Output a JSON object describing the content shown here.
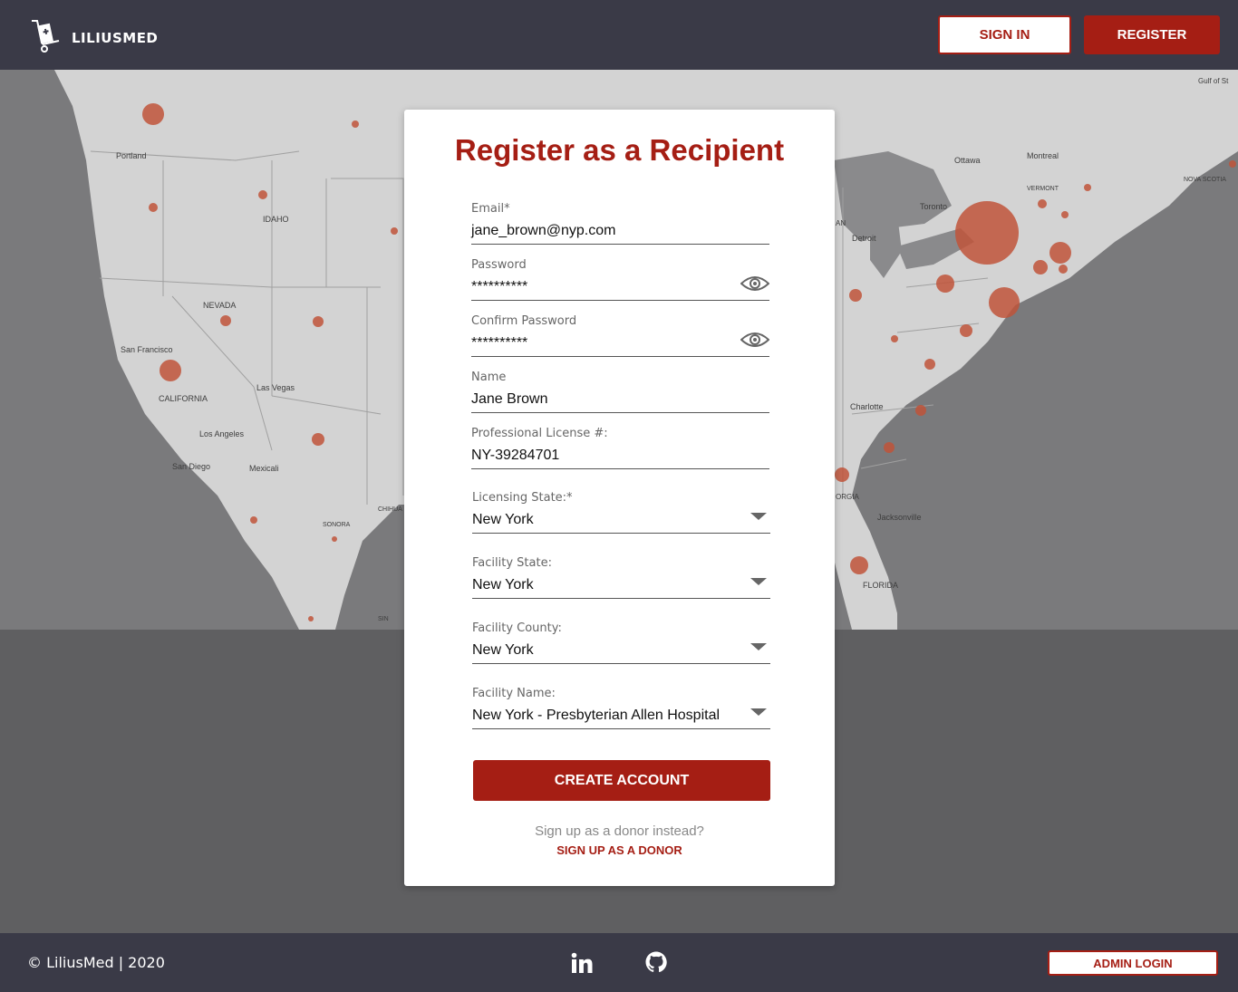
{
  "brand": {
    "name": "LILIUSMED",
    "accent": "#a51e14",
    "header_bg": "#3a3a47"
  },
  "header": {
    "signin_label": "SIGN IN",
    "register_label": "REGISTER"
  },
  "map": {
    "cities": [
      "Portland",
      "IDAHO",
      "NEVADA",
      "San Francisco",
      "CALIFORNIA",
      "Las Vegas",
      "Los Angeles",
      "San Diego",
      "Mexicali",
      "SONORA",
      "CHIHUA",
      "SIN",
      "Ottawa",
      "Montreal",
      "VERMONT",
      "NOVA SCOTIA",
      "Toronto",
      "AN",
      "Detroit",
      "Charlotte",
      "ORGIA",
      "Jacksonville",
      "FLORIDA",
      "Gulf of St"
    ]
  },
  "form": {
    "title": "Register as a Recipient",
    "email": {
      "label": "Email*",
      "value": "jane_brown@nyp.com"
    },
    "password": {
      "label": "Password",
      "value": "**********"
    },
    "confirm_password": {
      "label": "Confirm Password",
      "value": "**********"
    },
    "name": {
      "label": "Name",
      "value": "Jane Brown"
    },
    "license": {
      "label": "Professional License #:",
      "value": "NY-39284701"
    },
    "licensing_state": {
      "label": "Licensing State:*",
      "value": "New York"
    },
    "facility_state": {
      "label": "Facility State:",
      "value": "New York"
    },
    "facility_county": {
      "label": "Facility County:",
      "value": "New York"
    },
    "facility_name": {
      "label": "Facility Name:",
      "value": "New York - Presbyterian Allen Hospital"
    },
    "create_label": "CREATE ACCOUNT",
    "donor_question": "Sign up as a donor instead?",
    "donor_link": "SIGN UP AS A DONOR"
  },
  "footer": {
    "copyright": "©  LiliusMed | 2020",
    "linkedin_icon": "linkedin-icon",
    "github_icon": "github-icon",
    "admin_label": "ADMIN LOGIN"
  }
}
